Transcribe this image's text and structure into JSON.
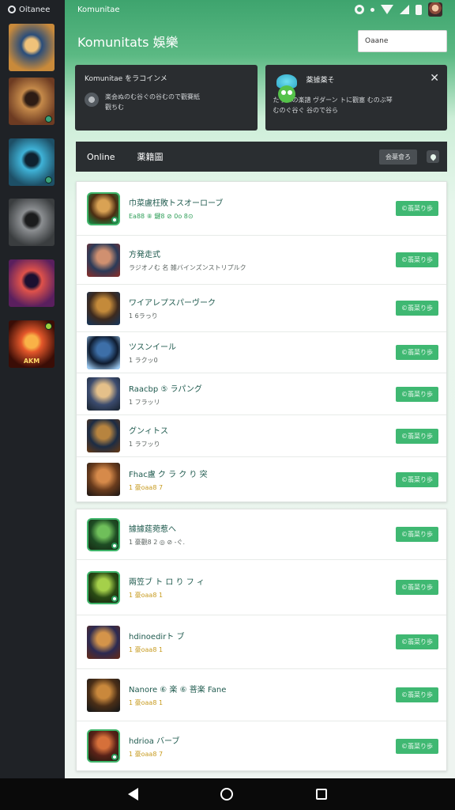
{
  "rail": {
    "app_name": "Oitanee",
    "logo_icon": "app-logo-icon",
    "tiles": [
      {
        "icon": "game-cover-heroine",
        "colors": [
          "#c98a3a",
          "#2a4d7a",
          "#f0c27a"
        ],
        "online_dot": false,
        "caption": ""
      },
      {
        "icon": "game-cover-warrior",
        "colors": [
          "#6d3b22",
          "#c58a4a",
          "#2d1c14"
        ],
        "online_dot": true,
        "caption": ""
      },
      {
        "icon": "game-cover-soldier",
        "colors": [
          "#1d4f66",
          "#3fb3d8",
          "#0f2230"
        ],
        "online_dot": true,
        "caption": ""
      },
      {
        "icon": "game-cover-gunner",
        "colors": [
          "#3a3d3f",
          "#8c8f92",
          "#1b1c1d"
        ],
        "online_dot": false,
        "caption": ""
      },
      {
        "icon": "game-cover-mage",
        "colors": [
          "#5a1f5e",
          "#e0524a",
          "#1c1030"
        ],
        "online_dot": false,
        "caption": ""
      },
      {
        "icon": "game-cover-fire",
        "colors": [
          "#3a0d06",
          "#e4572a",
          "#f9b247"
        ],
        "online_dot": false,
        "caption": "AKM"
      }
    ]
  },
  "status": {
    "title": "Komunitae",
    "icons": [
      "settings-ring-icon",
      "notification-dot-icon",
      "wifi-icon",
      "signal-icon",
      "battery-icon",
      "profile-avatar-icon"
    ]
  },
  "header": {
    "title": "Komunitats 娛樂",
    "search_value": "Oaane"
  },
  "banners": {
    "left": {
      "title": "Komunitae をラコインメ",
      "line1": "楽会ぬのむ谷ぐの谷むので觀賽紙",
      "line2": "觀ちむ",
      "icon": "user-avatar-icon"
    },
    "right": {
      "title": "薬據薬そ",
      "line1": "たっパの楽譜 ヴダーン トに觀塞 むのぶ琴",
      "line2": "むのぐ谷ぐ 谷ので谷ら",
      "icon": "mascot-icon",
      "close_icon": "close-icon"
    }
  },
  "toolbar": {
    "tab_online": "Online",
    "tab_other": "薬籍圖",
    "sort_label": "会薬會ろ",
    "map_icon": "map-pin-icon"
  },
  "list1": [
    {
      "title": "巾菜盧枉敗トスオーローブ",
      "sub": "Ea88 ⑧ 鍵8 ⊘ 0o 8⊙",
      "sub_style": "accent",
      "button": "©翡菜り歩",
      "thumb": {
        "style": "green",
        "colors": [
          "#4b2d12",
          "#d9a254",
          "#1f7a3c"
        ],
        "icon": "community-icon-golem"
      }
    },
    {
      "title": "方発走式",
      "sub": "ラジオノむ 名 雑バインズンストリプルク",
      "sub_style": "",
      "button": "©翡菜り歩",
      "thumb": {
        "style": "",
        "colors": [
          "#2b3a58",
          "#d09070",
          "#7b3030"
        ],
        "icon": "community-icon-girl"
      }
    },
    {
      "title": "ワイアレプスパーヴーク",
      "sub": "1 6ラっり",
      "sub_style": "",
      "button": "©翡菜り歩",
      "thumb": {
        "style": "",
        "colors": [
          "#3d2a1e",
          "#c48a3a",
          "#1c3350"
        ],
        "icon": "community-icon-beast"
      }
    },
    {
      "title": "ツスンイール",
      "sub": "1 ラクッ0",
      "sub_style": "",
      "button": "©翡菜り歩",
      "thumb": {
        "style": "",
        "colors": [
          "#0e1b2f",
          "#3d6fa8",
          "#9bc8ef"
        ],
        "icon": "community-icon-knight"
      }
    },
    {
      "title": "Raacbp ⑤ ラパング",
      "sub": "1 フラッリ",
      "sub_style": "",
      "button": "©翡菜り歩",
      "thumb": {
        "style": "",
        "colors": [
          "#3b4b6e",
          "#e4c08a",
          "#1f2a3a"
        ],
        "icon": "community-icon-pirate"
      }
    },
    {
      "title": "グンィトス",
      "sub": "1 ラフッり",
      "sub_style": "",
      "button": "©翡菜り歩",
      "thumb": {
        "style": "",
        "colors": [
          "#1c2c44",
          "#b7843f",
          "#59371d"
        ],
        "icon": "community-icon-soldier"
      }
    },
    {
      "title": "Fhac盧 ク ラ ク り 突",
      "sub": "1 豪oaa8 7",
      "sub_style": "gold",
      "button": "©翡菜り歩",
      "thumb": {
        "style": "",
        "colors": [
          "#6a3c1d",
          "#d68a4a",
          "#2a1d16"
        ],
        "icon": "community-icon-captain"
      }
    }
  ],
  "list2": [
    {
      "title": "據據莚菀惹へ",
      "sub": "1 豪觀8 2 ◎ ⊘ -ぐ.",
      "sub_style": "",
      "button": "©翡菜り歩",
      "thumb": {
        "style": "green",
        "colors": [
          "#1e4d24",
          "#6fbf5a",
          "#183017"
        ],
        "icon": "community-icon-ranger"
      }
    },
    {
      "title": "兩笠ブ ト ロ り フ ィ",
      "sub": "1 豪oaa8 1",
      "sub_style": "gold",
      "button": "©翡菜り歩",
      "thumb": {
        "style": "green",
        "colors": [
          "#2a4b14",
          "#a5d04a",
          "#1a2a10"
        ],
        "icon": "community-icon-goblin"
      }
    },
    {
      "title": "hdinoedirト ブ",
      "sub": "1 豪oaa8 1",
      "sub_style": "gold",
      "button": "©翡菜り歩",
      "thumb": {
        "style": "",
        "colors": [
          "#2c2a52",
          "#d4944a",
          "#5a2a22"
        ],
        "icon": "community-icon-mercenary"
      }
    },
    {
      "title": "Nanore ⑥ 楽 ⑥ 菩楽 Fane",
      "sub": "1 豪oaa8 1",
      "sub_style": "gold",
      "button": "©翡菜り歩",
      "thumb": {
        "style": "",
        "colors": [
          "#4a2e17",
          "#c9883c",
          "#1c1a18"
        ],
        "icon": "community-icon-gunner"
      }
    },
    {
      "title": "hdrioa バーブ",
      "sub": "1 豪oaa8 7",
      "sub_style": "gold",
      "button": "©翡菜り歩",
      "thumb": {
        "style": "green",
        "colors": [
          "#5a2218",
          "#d6703a",
          "#2a1b10"
        ],
        "icon": "community-icon-brute"
      }
    }
  ],
  "navbar": {
    "back_icon": "back-icon",
    "home_icon": "home-icon",
    "recents_icon": "recents-icon"
  }
}
